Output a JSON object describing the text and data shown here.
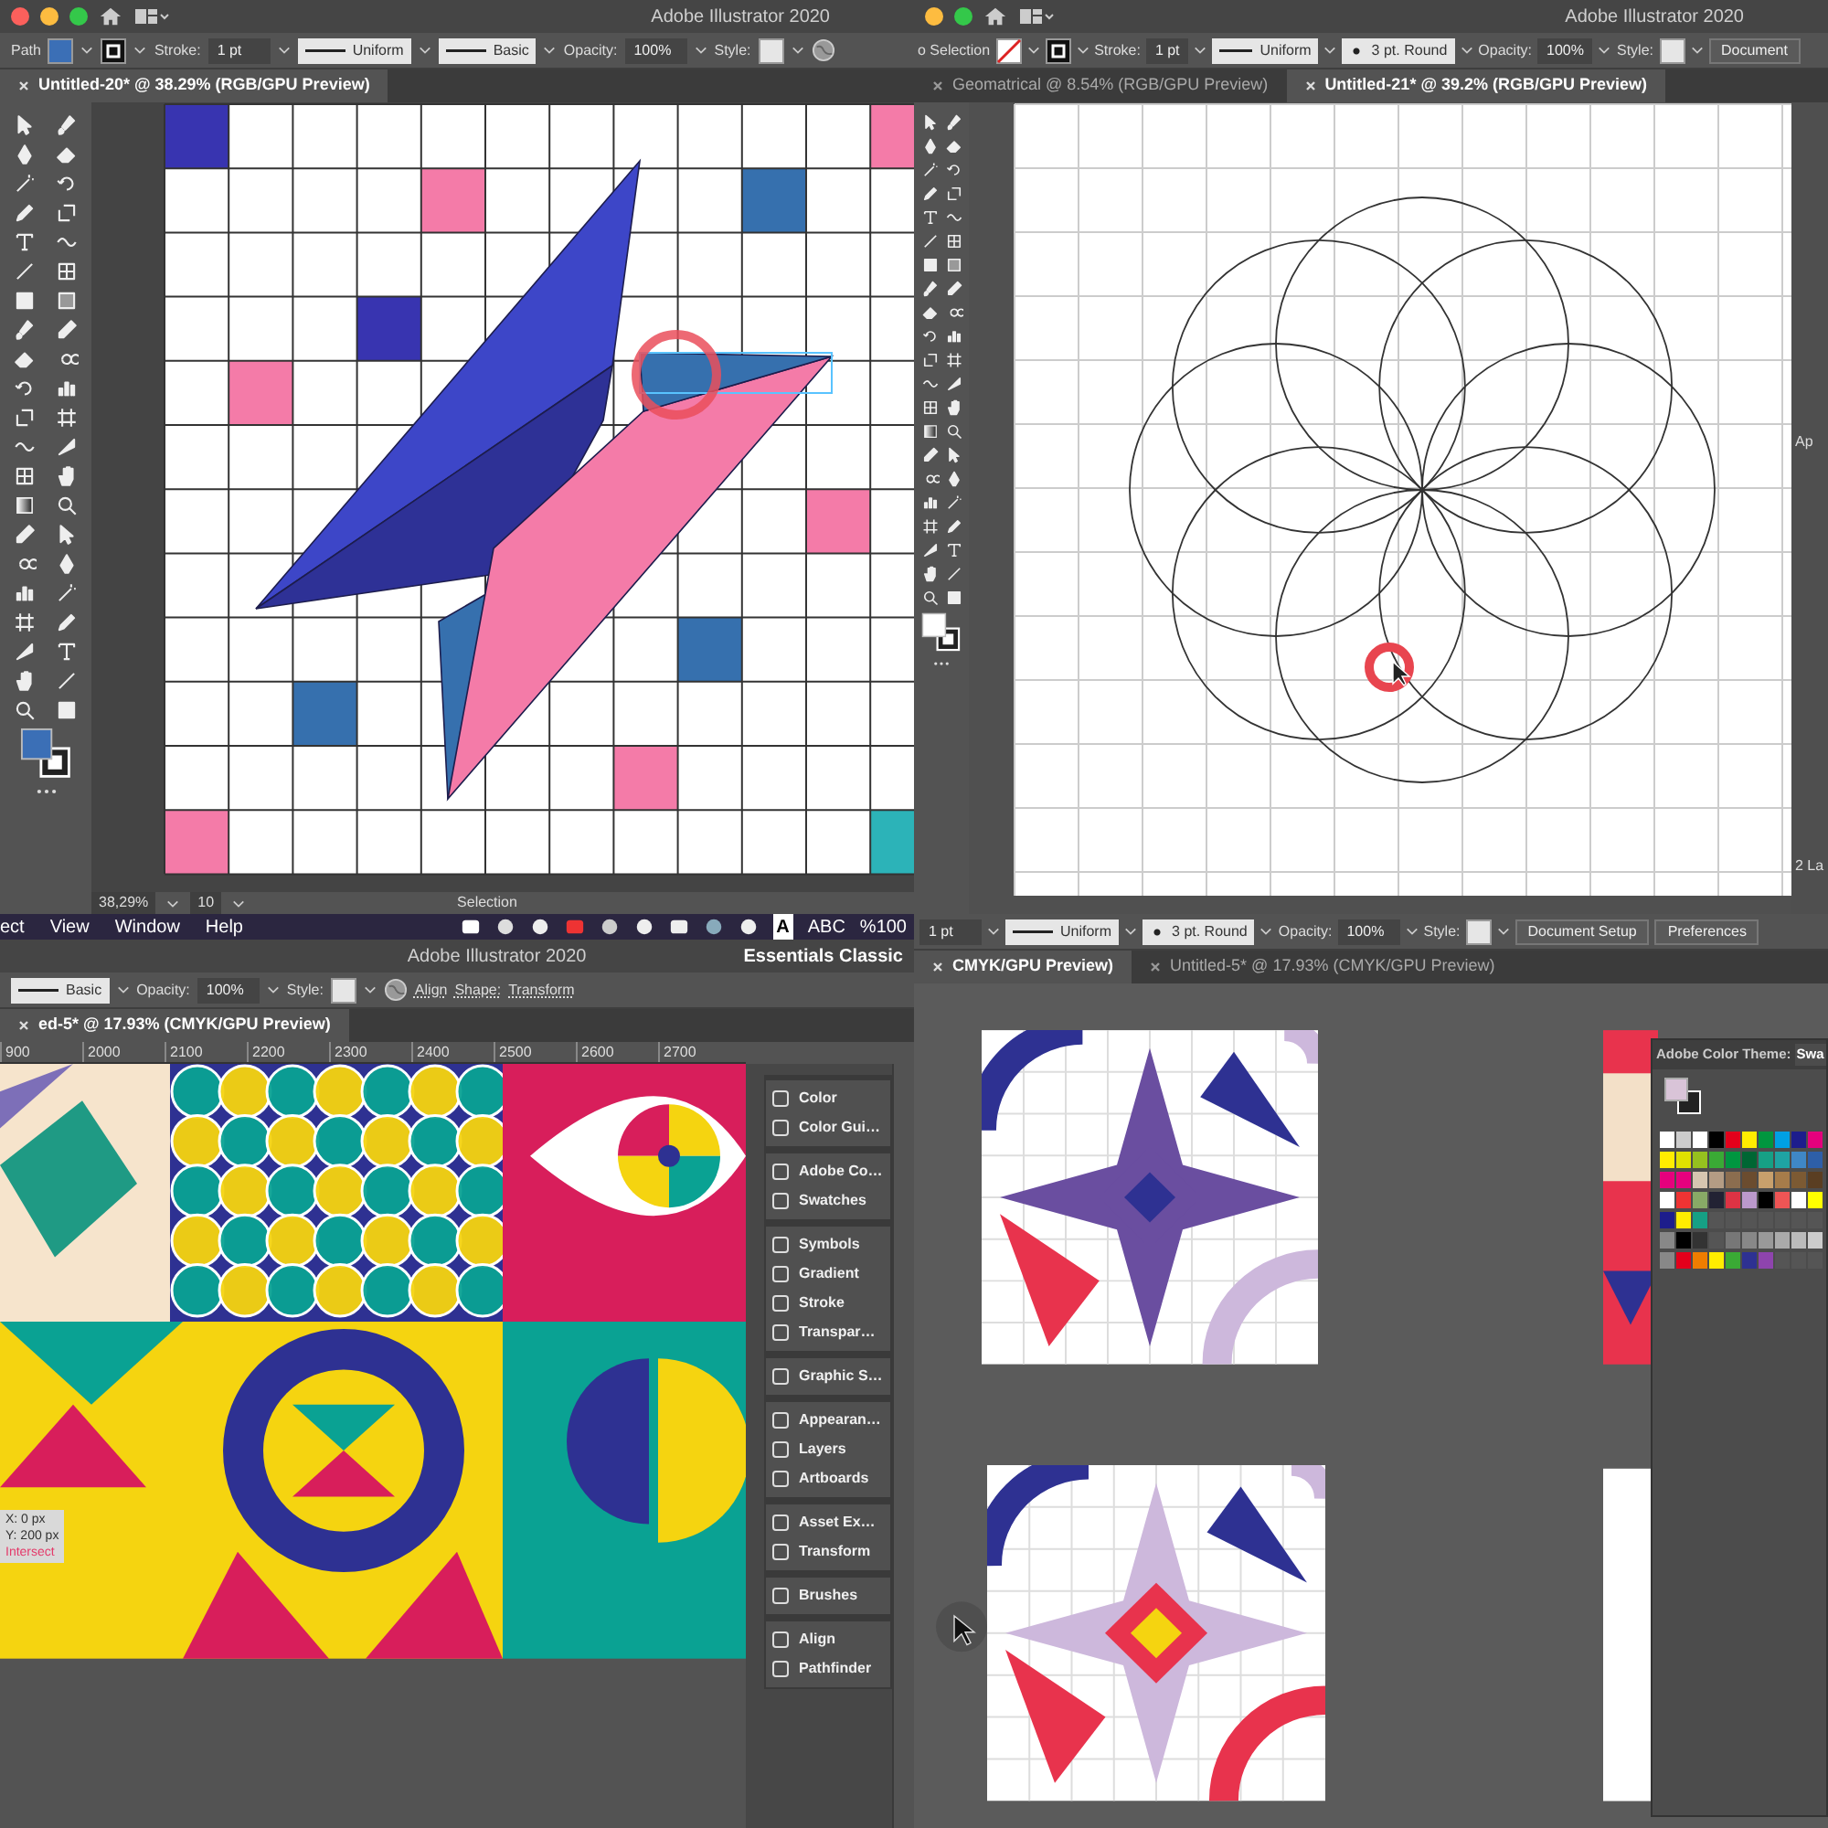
{
  "panes": [
    {
      "title_bar": {
        "lights": [
          {
            "color": "#fc605c"
          },
          {
            "color": "#fdbc40"
          },
          {
            "color": "#34c84a"
          }
        ],
        "title": "Adobe Illustrator 2020"
      },
      "control_bar": [
        {
          "kind": "label",
          "text": "Path"
        },
        {
          "kind": "fill",
          "color": "#3b6fb6"
        },
        {
          "kind": "stroke"
        },
        {
          "kind": "label",
          "text": "Stroke:"
        },
        {
          "kind": "field",
          "text": "1 pt"
        },
        {
          "kind": "line",
          "text": "Uniform"
        },
        {
          "kind": "line",
          "text": "Basic"
        },
        {
          "kind": "label",
          "text": "Opacity:"
        },
        {
          "kind": "field",
          "text": "100%"
        },
        {
          "kind": "label",
          "text": "Style:"
        },
        {
          "kind": "style"
        },
        {
          "kind": "globe"
        }
      ],
      "tabs": [
        {
          "label": "Untitled-20* @ 38.29% (RGB/GPU Preview)",
          "selected": true
        }
      ],
      "toolbar": {
        "fill": {
          "color": "#3b6fb6"
        }
      },
      "canvas": {
        "kind": "grid-star"
      },
      "status_bar": {
        "zoom": "38,29%",
        "artboard": "10",
        "tool": "Selection"
      }
    },
    {
      "title_bar": {
        "lights": [
          {
            "color": "#fdbc40"
          },
          {
            "color": "#34c84a"
          }
        ],
        "title": "Adobe Illustrator 2020"
      },
      "control_bar": [
        {
          "kind": "label",
          "text": "o Selection"
        },
        {
          "kind": "nofill"
        },
        {
          "kind": "stroke"
        },
        {
          "kind": "label",
          "text": "Stroke:"
        },
        {
          "kind": "field",
          "text": "1 pt"
        },
        {
          "kind": "line",
          "text": "Uniform"
        },
        {
          "kind": "dot",
          "text": "3 pt. Round"
        },
        {
          "kind": "label",
          "text": "Opacity:"
        },
        {
          "kind": "field",
          "text": "100%"
        },
        {
          "kind": "label",
          "text": "Style:"
        },
        {
          "kind": "style"
        },
        {
          "kind": "button",
          "text": "Document"
        }
      ],
      "tabs": [
        {
          "label": "Geomatrical @ 8.54% (RGB/GPU Preview)",
          "selected": false
        },
        {
          "label": "Untitled-21* @ 39.2% (RGB/GPU Preview)",
          "selected": true
        }
      ],
      "toolbar": {
        "fill": {
          "color": "#ffffff"
        }
      },
      "canvas": {
        "kind": "circles"
      },
      "side_panel": {
        "header": "Ap",
        "footer": "2 La"
      }
    },
    {
      "menu_bar": {
        "items": [
          "ect",
          "View",
          "Window",
          "Help"
        ],
        "status_items": [
          "A",
          "ABC",
          "%100"
        ]
      },
      "title_bar": {
        "title": "Adobe Illustrator 2020",
        "workspace": "Essentials Classic"
      },
      "control_bar": [
        {
          "kind": "line",
          "text": "Basic"
        },
        {
          "kind": "label",
          "text": "Opacity:"
        },
        {
          "kind": "field",
          "text": "100%"
        },
        {
          "kind": "label",
          "text": "Style:"
        },
        {
          "kind": "style"
        },
        {
          "kind": "globe"
        },
        {
          "kind": "link",
          "text": "Align"
        },
        {
          "kind": "link",
          "text": "Shape:"
        },
        {
          "kind": "link",
          "text": "Transform"
        }
      ],
      "tabs": [
        {
          "label": "ed-5* @ 17.93% (CMYK/GPU Preview)",
          "selected": true
        }
      ],
      "ruler": [
        "900",
        "2000",
        "2100",
        "2200",
        "2300",
        "2400",
        "2500",
        "2600",
        "2700"
      ],
      "canvas": {
        "kind": "tiles"
      },
      "tooltip": [
        "X: 0 px",
        "Y: 200 px",
        "Intersect"
      ],
      "panels": [
        [
          "Color",
          "Color Gui…"
        ],
        [
          "Adobe Co…",
          "Swatches"
        ],
        [
          "Symbols",
          "Gradient",
          "Stroke",
          "Transpar…"
        ],
        [
          "Graphic S…"
        ],
        [
          "Appearan…",
          "Layers",
          "Artboards"
        ],
        [
          "Asset Ex…",
          "Transform"
        ],
        [
          "Brushes"
        ],
        [
          "Align",
          "Pathfinder"
        ]
      ]
    },
    {
      "control_bar": [
        {
          "kind": "field",
          "text": "1 pt"
        },
        {
          "kind": "line",
          "text": "Uniform"
        },
        {
          "kind": "dot",
          "text": "3 pt. Round"
        },
        {
          "kind": "label",
          "text": "Opacity:"
        },
        {
          "kind": "field",
          "text": "100%"
        },
        {
          "kind": "label",
          "text": "Style:"
        },
        {
          "kind": "style"
        },
        {
          "kind": "button",
          "text": "Document Setup"
        },
        {
          "kind": "button",
          "text": "Preferences"
        }
      ],
      "tabs": [
        {
          "label": "CMYK/GPU Preview)",
          "selected": true
        },
        {
          "label": "Untitled-5* @ 17.93% (CMYK/GPU Preview)",
          "selected": false
        }
      ],
      "canvas": {
        "kind": "artboards"
      },
      "swatch_panel": {
        "tabs": [
          "Adobe Color Theme:",
          "Swa"
        ]
      }
    }
  ]
}
